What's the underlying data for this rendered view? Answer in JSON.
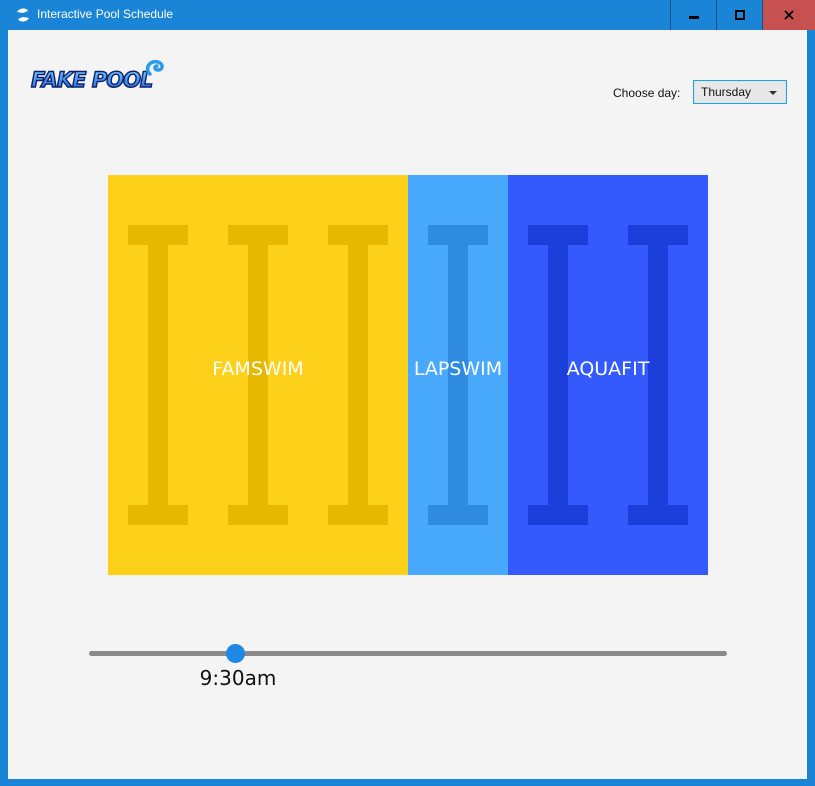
{
  "window": {
    "title": "Interactive Pool Schedule",
    "app_icon": "swirl-icon",
    "controls": {
      "minimize": "minimize-icon",
      "maximize": "maximize-icon",
      "close": "close-icon"
    }
  },
  "logo": {
    "text": "FAKE POOL"
  },
  "day_picker": {
    "label": "Choose day:",
    "selected": "Thursday"
  },
  "pool": {
    "activities": [
      {
        "name": "FAMSWIM",
        "lanes": 3,
        "color": "#fdd01a",
        "lane_color": "#e6b800"
      },
      {
        "name": "LAPSWIM",
        "lanes": 1,
        "color": "#48a8fb",
        "lane_color": "#2e8be0"
      },
      {
        "name": "AQUAFIT",
        "lanes": 2,
        "color": "#3459fd",
        "lane_color": "#1c3fdc"
      }
    ]
  },
  "time_slider": {
    "value_label": "9:30am",
    "position": 0.23
  },
  "colors": {
    "titlebar": "#1a85d6",
    "close_button": "#c75050",
    "background": "#f4f4f5",
    "accent": "#1e88e5"
  }
}
